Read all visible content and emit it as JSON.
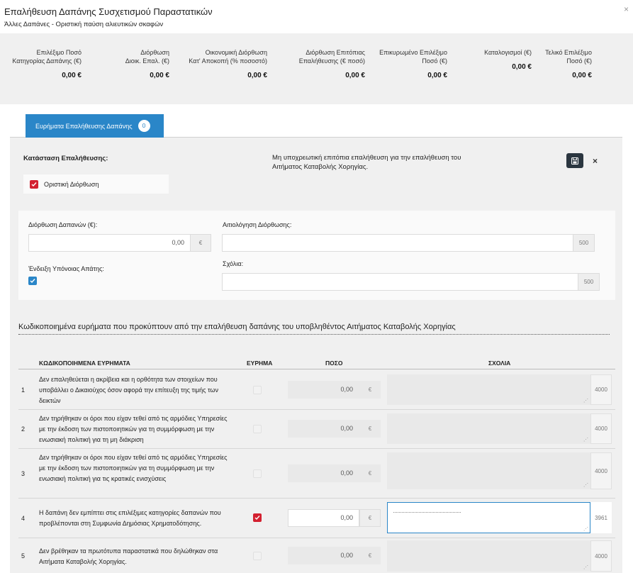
{
  "header": {
    "title": "Επαλήθευση Δαπάνης Συσχετισμού Παραστατικών",
    "subtitle": "Άλλες Δαπάνες - Οριστική παύση αλιευτικών σκαφών",
    "close_icon": "×"
  },
  "summary": [
    {
      "label1": "Επιλέξιμο Ποσό",
      "label2": "Κατηγορίας Δαπάνης (€)",
      "value": "0,00 €"
    },
    {
      "label1": "Διόρθωση",
      "label2": "Διοικ. Επαλ. (€)",
      "value": "0,00 €"
    },
    {
      "label1": "Οικονομική Διόρθωση",
      "label2": "Κατ' Αποκοπή (% ποσοστό)",
      "value": "0,00 €"
    },
    {
      "label1": "Διόρθωση Επιτόπιας",
      "label2": "Επαλήθευσης (€ ποσό)",
      "value": "0,00 €"
    },
    {
      "label1": "Επικυρωμένο Επιλέξιμο",
      "label2": "Ποσό (€)",
      "value": "0,00 €"
    },
    {
      "label1": "Καταλογισμοί (€)",
      "label2": "",
      "value": "0,00 €"
    },
    {
      "label1": "Τελικό Επιλέξιμο",
      "label2": "Ποσό (€)",
      "value": "0,00 €"
    }
  ],
  "tab": {
    "label": "Ευρήματα Επαλήθευσης Δαπάνης",
    "count": "0"
  },
  "verification": {
    "status_label": "Κατάσταση Επαλήθευσης:",
    "status_note": "Μη υποχρεωτική επιτόπια επαλήθευση για την επαλήθευση του Αιτήματος Καταβολής Χορηγίας.",
    "final_correction_label": "Οριστική Διόρθωση",
    "close_icon": "×"
  },
  "form": {
    "correction_label": "Διόρθωση Δαπανών (€):",
    "correction_value": "0,00",
    "currency": "€",
    "justification_label": "Αιτιολόγηση Διόρθωσης:",
    "justification_count": "500",
    "fraud_label": "Ένδειξη Υπόνοιας Απάτης:",
    "comments_label": "Σχόλια:",
    "comments_count": "500"
  },
  "findings": {
    "title": "Κωδικοποιημένα ευρήματα που προκύπτουν από την επαλήθευση δαπάνης του υποβληθέντος Αιτήματος Καταβολής Χορηγίας",
    "columns": {
      "findings": "ΚΩΔΙΚΟΠΟΙΗΜΕΝΑ ΕΥΡΗΜΑΤΑ",
      "finding": "ΕΥΡΗΜΑ",
      "amount": "ΠΟΣΟ",
      "comments": "ΣΧΟΛΙΑ"
    },
    "rows": [
      {
        "num": "1",
        "text": "Δεν επαληθεύεται η ακρίβεια και η ορθότητα των στοιχείων που υποβάλλει ο Δικαιούχος όσον αφορά την επίτευξη της τιμής των δεικτών",
        "checked": false,
        "amount": "0,00",
        "currency": "€",
        "count": "4000"
      },
      {
        "num": "2",
        "text": "Δεν τηρήθηκαν οι όροι που είχαν τεθεί από τις αρμόδιες Υπηρεσίες με την έκδοση των πιστοποιητικών για τη συμμόρφωση με την ενωσιακή πολιτική για τη μη διάκριση",
        "checked": false,
        "amount": "0,00",
        "currency": "€",
        "count": "4000"
      },
      {
        "num": "3",
        "text": "Δεν τηρήθηκαν οι όροι που είχαν τεθεί από τις αρμόδιες Υπηρεσίες με την έκδοση των πιστοποιητικών για τη συμμόρφωση με την ενωσιακή πολιτική για τις κρατικές ενισχύσεις",
        "checked": false,
        "amount": "0,00",
        "currency": "€",
        "count": "4000"
      },
      {
        "num": "4",
        "text": "Η δαπάνη δεν εμπίπτει στις επιλέξιμες κατηγορίες δαπανών που προβλέπονται στη Συμφωνία Δημόσιας Χρηματοδότησης.",
        "checked": true,
        "amount": "0,00",
        "currency": "€",
        "count": "3961"
      },
      {
        "num": "5",
        "text": "Δεν βρέθηκαν τα πρωτότυπα παραστατικά που δηλώθηκαν στα Αιτήματα Καταβολής Χορηγίας.",
        "checked": false,
        "amount": "0,00",
        "currency": "€",
        "count": "4000"
      }
    ]
  }
}
